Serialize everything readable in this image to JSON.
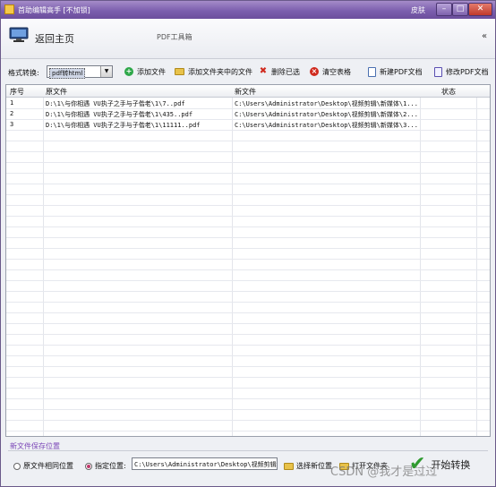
{
  "window": {
    "title": "首助编辑高手 [不加锁]",
    "skin_label": "皮肤"
  },
  "header": {
    "home_label": "返回主页",
    "tool_title": "PDF工具箱",
    "collapse_glyph": "«"
  },
  "toolbar": {
    "format_label": "格式转换:",
    "format_value": "pdf转html",
    "add_file": "添加文件",
    "add_folder_files": "添加文件夹中的文件",
    "delete_selected": "删除已选",
    "clear_table": "清空表格",
    "new_pdf": "新建PDF文档",
    "edit_pdf": "修改PDF文档"
  },
  "table": {
    "columns": [
      "序号",
      "原文件",
      "新文件",
      "状态"
    ],
    "rows": [
      {
        "no": "1",
        "src": "D:\\1\\与你相遇 VU执子之手与子偕老\\1\\7..pdf",
        "dst": "C:\\Users\\Administrator\\Desktop\\视频剪辑\\新媒体\\1...",
        "status": ""
      },
      {
        "no": "2",
        "src": "D:\\1\\与你相遇 VU执子之手与子偕老\\1\\435..pdf",
        "dst": "C:\\Users\\Administrator\\Desktop\\视频剪辑\\新媒体\\2...",
        "status": ""
      },
      {
        "no": "3",
        "src": "D:\\1\\与你相遇 VU执子之手与子偕老\\1\\11111..pdf",
        "dst": "C:\\Users\\Administrator\\Desktop\\视频剪辑\\新媒体\\3...",
        "status": ""
      }
    ]
  },
  "save": {
    "title": "新文件保存位置",
    "same_as_source": "原文件相同位置",
    "specified": "指定位置:",
    "path": "C:\\Users\\Administrator\\Desktop\\视频剪辑\\新",
    "choose": "选择新位置",
    "open_folder": "打开文件夹",
    "start": "开始转换",
    "watermark": "CSDN @我才是过过"
  }
}
